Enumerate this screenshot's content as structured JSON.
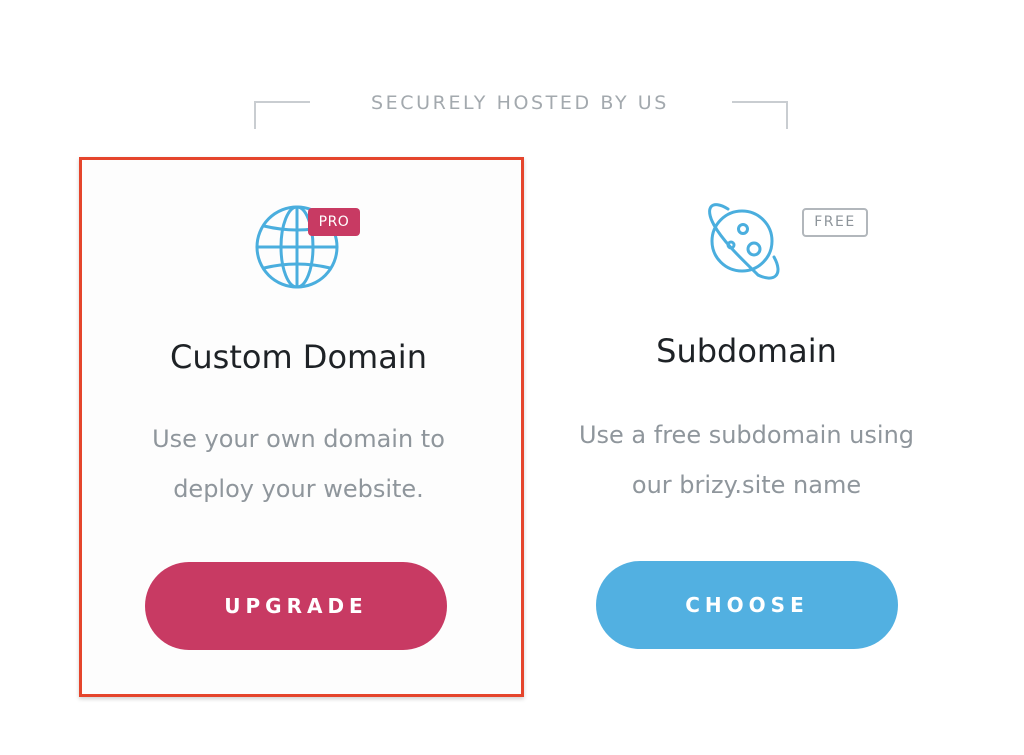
{
  "header": {
    "title": "SECURELY HOSTED BY US"
  },
  "cards": [
    {
      "id": "custom-domain",
      "icon": "globe-icon",
      "badge": "PRO",
      "title": "Custom Domain",
      "description_lines": [
        "Use your own domain to",
        "deploy your website."
      ],
      "button_label": "UPGRADE",
      "selected": true
    },
    {
      "id": "subdomain",
      "icon": "planet-icon",
      "badge": "FREE",
      "title": "Subdomain",
      "description_lines": [
        "Use a free subdomain using",
        "our brizy.site name"
      ],
      "button_label": "CHOOSE",
      "selected": false
    }
  ],
  "colors": {
    "accent_pink": "#c83a63",
    "accent_blue": "#52b0e1",
    "icon_blue": "#4aaede",
    "selection_outline": "#e5452c"
  }
}
